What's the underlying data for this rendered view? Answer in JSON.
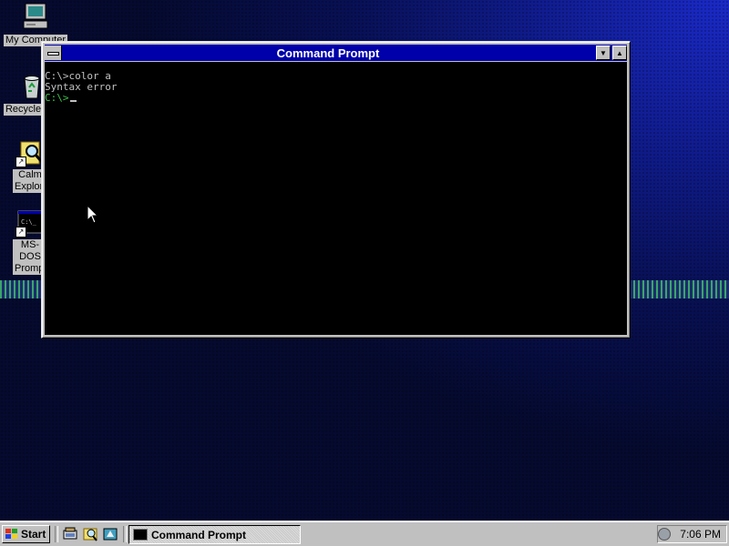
{
  "desktop": {
    "icons": [
      {
        "label": "My Computer"
      },
      {
        "label": "Recycle Bin"
      },
      {
        "label": "Calm Explorer"
      },
      {
        "label": "MS-DOS Prompt"
      }
    ]
  },
  "window": {
    "title": "Command Prompt",
    "lines": [
      {
        "text": "C:\\>color a"
      },
      {
        "text": "Syntax error"
      },
      {
        "text": "C:\\>"
      }
    ]
  },
  "taskbar": {
    "start_label": "Start",
    "task_button_label": "Command Prompt",
    "clock": "7:06 PM",
    "quick_launch": [
      "desktop-icon",
      "explorer-icon",
      "channels-icon"
    ]
  },
  "colors": {
    "titlebar": "#0000aa",
    "console_bg": "#000000",
    "console_text": "#c0c0c0",
    "prompt_green": "#3ec44a",
    "face": "#c0c0c0"
  }
}
